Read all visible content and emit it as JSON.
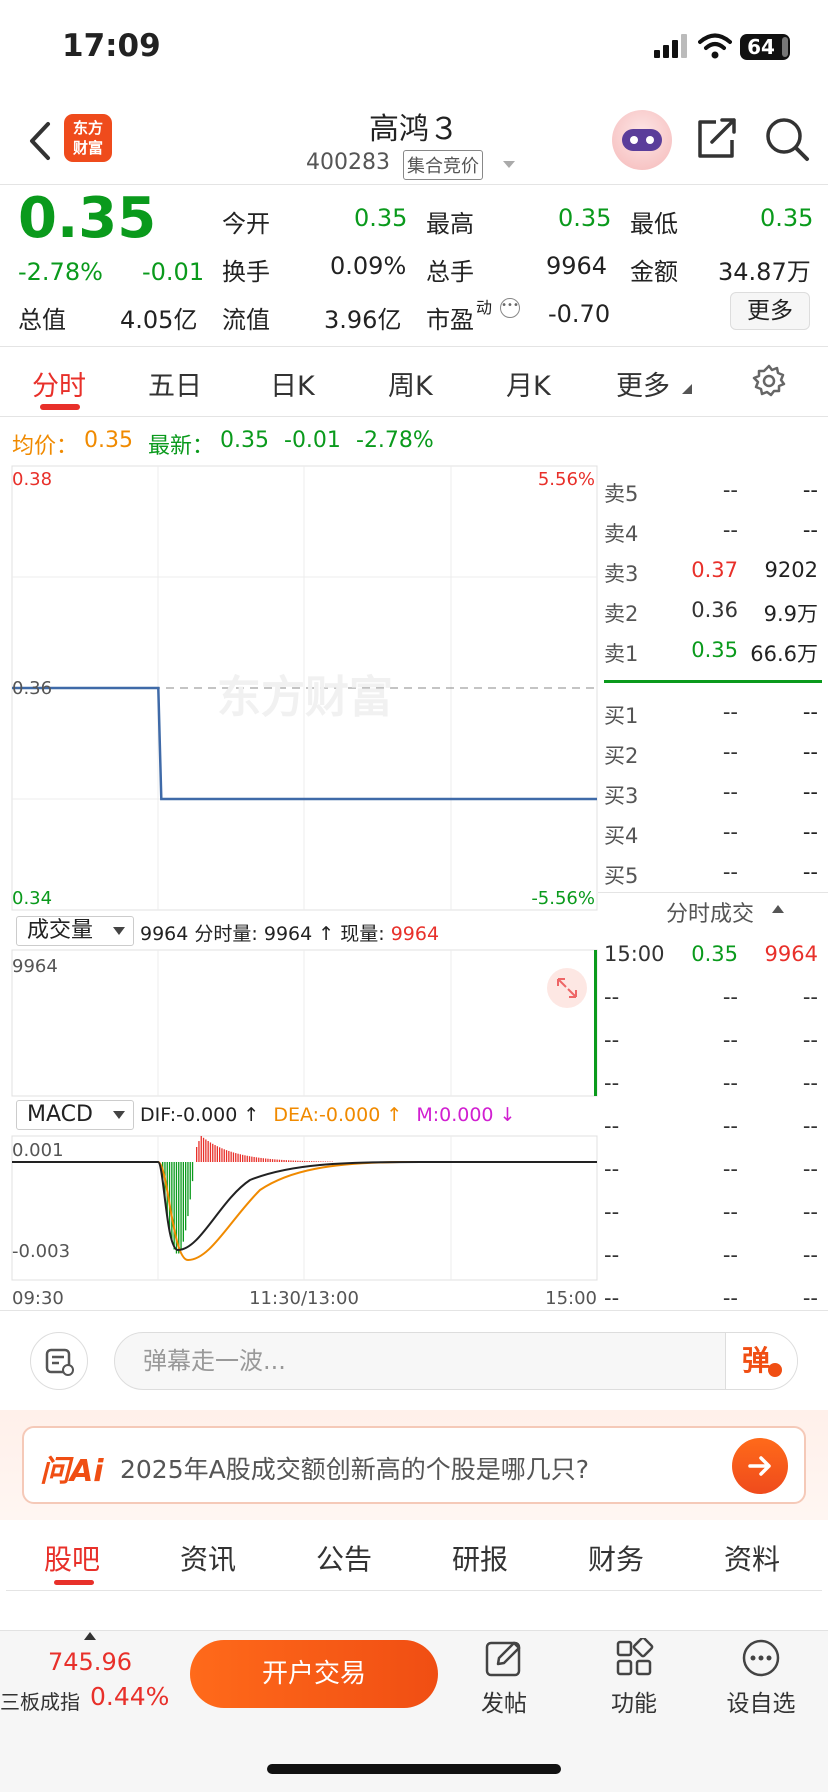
{
  "status": {
    "time": "17:09",
    "battery": "64"
  },
  "header": {
    "logo_line1": "东方",
    "logo_line2": "财富",
    "name": "高鸿３",
    "code": "400283",
    "badge": "集合竞价"
  },
  "quote": {
    "price": "0.35",
    "change_pct": "-2.78%",
    "change": "-0.01",
    "open_label": "今开",
    "open": "0.35",
    "high_label": "最高",
    "high": "0.35",
    "low_label": "最低",
    "low": "0.35",
    "turnover_label": "换手",
    "turnover": "0.09%",
    "volume_label": "总手",
    "volume": "9964",
    "amount_label": "金额",
    "amount": "34.87万",
    "mktcap_label": "总值",
    "mktcap": "4.05亿",
    "float_label": "流值",
    "float_cap": "3.96亿",
    "pe_label": "市盈",
    "pe_sup": "动",
    "pe": "-0.70",
    "more": "更多"
  },
  "tabs": [
    "分时",
    "五日",
    "日K",
    "周K",
    "月K",
    "更多"
  ],
  "legend": {
    "avg_label": "均价：",
    "avg": "0.35",
    "last_label": "最新：",
    "last": "0.35",
    "chg": "-0.01",
    "pct": "-2.78%"
  },
  "chart_labels": {
    "y_top": "0.38",
    "y_mid": "0.36",
    "y_bottom": "0.34",
    "pct_top": "5.56%",
    "pct_bottom": "-5.56%",
    "vol_max": "9964",
    "macd_top": "0.001",
    "macd_bottom": "-0.003",
    "time_start": "09:30",
    "time_mid": "11:30/13:00",
    "time_end": "15:00",
    "watermark": "东方财富"
  },
  "chart_data": [
    {
      "type": "line",
      "title": "分时",
      "x": [
        "09:30",
        "10:30",
        "10:30",
        "15:00"
      ],
      "y": [
        0.36,
        0.36,
        0.35,
        0.35
      ],
      "prev_close": 0.36,
      "ylim": [
        0.34,
        0.38
      ]
    },
    {
      "type": "bar",
      "title": "成交量",
      "x": [
        "15:00"
      ],
      "values": [
        9964
      ]
    },
    {
      "type": "line",
      "title": "MACD",
      "ylim": [
        -0.003,
        0.001
      ],
      "series": [
        {
          "name": "DIF",
          "value": -0.0
        },
        {
          "name": "DEA",
          "value": -0.0
        },
        {
          "name": "M",
          "value": 0.0
        }
      ]
    }
  ],
  "volume_bar": {
    "selector": "成交量",
    "total": "9964",
    "fs_label": "分时量:",
    "fs_val": "9964",
    "now_label": "现量:",
    "now_val": "9964"
  },
  "macd_bar": {
    "selector": "MACD",
    "dif": "DIF:-0.000",
    "dea": "DEA:-0.000",
    "m": "M:0.000"
  },
  "order_book": {
    "sell": [
      {
        "label": "卖5",
        "price": "--",
        "vol": "--"
      },
      {
        "label": "卖4",
        "price": "--",
        "vol": "--"
      },
      {
        "label": "卖3",
        "price": "0.37",
        "vol": "9202"
      },
      {
        "label": "卖2",
        "price": "0.36",
        "vol": "9.9万"
      },
      {
        "label": "卖1",
        "price": "0.35",
        "vol": "66.6万"
      }
    ],
    "buy": [
      {
        "label": "买1",
        "price": "--",
        "vol": "--"
      },
      {
        "label": "买2",
        "price": "--",
        "vol": "--"
      },
      {
        "label": "买3",
        "price": "--",
        "vol": "--"
      },
      {
        "label": "买4",
        "price": "--",
        "vol": "--"
      },
      {
        "label": "买5",
        "price": "--",
        "vol": "--"
      }
    ]
  },
  "trades": {
    "title": "分时成交",
    "rows": [
      {
        "time": "15:00",
        "price": "0.35",
        "vol": "9964"
      },
      {
        "time": "--",
        "price": "--",
        "vol": "--"
      },
      {
        "time": "--",
        "price": "--",
        "vol": "--"
      },
      {
        "time": "--",
        "price": "--",
        "vol": "--"
      },
      {
        "time": "--",
        "price": "--",
        "vol": "--"
      },
      {
        "time": "--",
        "price": "--",
        "vol": "--"
      },
      {
        "time": "--",
        "price": "--",
        "vol": "--"
      },
      {
        "time": "--",
        "price": "--",
        "vol": "--"
      },
      {
        "time": "--",
        "price": "--",
        "vol": "--"
      }
    ]
  },
  "danmu": {
    "placeholder": "弹幕走一波...",
    "send": "弹"
  },
  "ai": {
    "logo": "问Ai",
    "question": "2025年A股成交额创新高的个股是哪几只?"
  },
  "forum_tabs": [
    "股吧",
    "资讯",
    "公告",
    "研报",
    "财务",
    "资料"
  ],
  "bottom": {
    "index_val": "745.96",
    "index_name": "三板成指",
    "index_pct": "0.44%",
    "open_account": "开户交易",
    "post": "发帖",
    "func": "功能",
    "watch": "设自选"
  }
}
